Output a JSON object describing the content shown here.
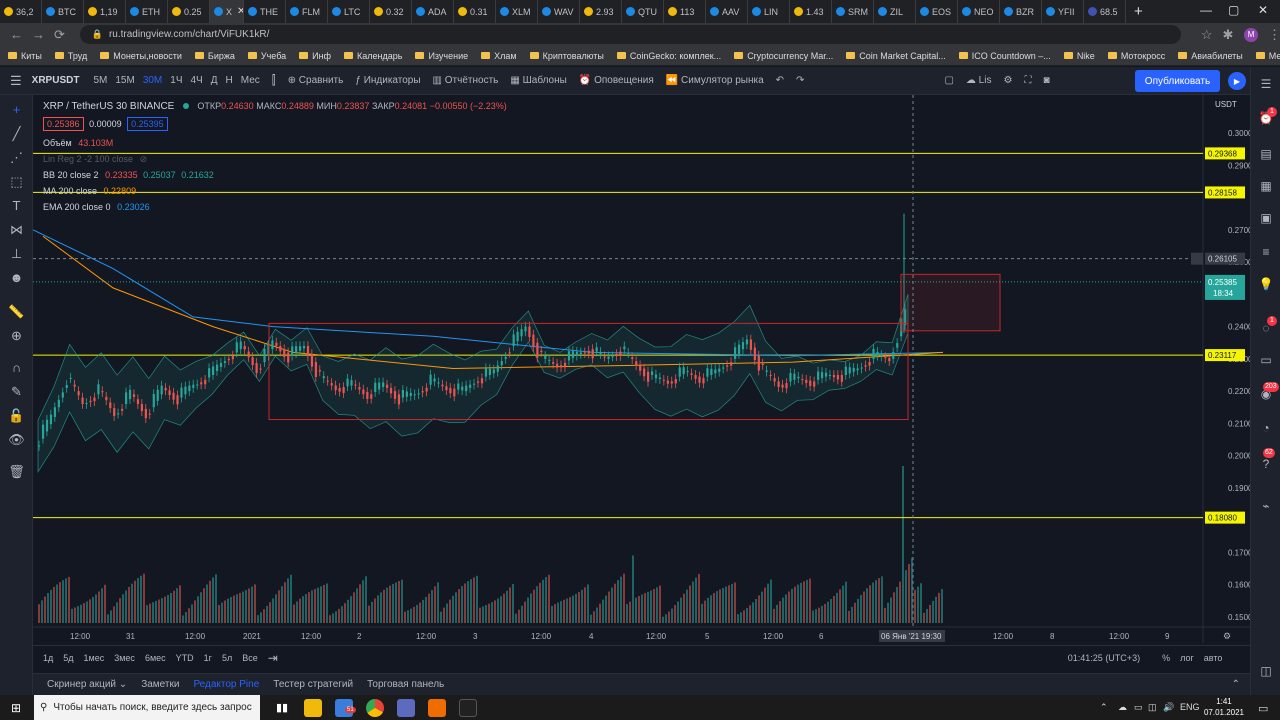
{
  "browser": {
    "tabs": [
      {
        "label": "36,2",
        "color": "#f0b90b"
      },
      {
        "label": "BTC",
        "color": "#1e88e5"
      },
      {
        "label": "1,19",
        "color": "#f0b90b"
      },
      {
        "label": "ETH",
        "color": "#1e88e5"
      },
      {
        "label": "0.25",
        "color": "#f0b90b"
      },
      {
        "label": "X",
        "color": "#1e88e5",
        "active": true
      },
      {
        "label": "THE",
        "color": "#1e88e5"
      },
      {
        "label": "FLM",
        "color": "#1e88e5"
      },
      {
        "label": "LTC",
        "color": "#1e88e5"
      },
      {
        "label": "0.32",
        "color": "#f0b90b"
      },
      {
        "label": "ADA",
        "color": "#1e88e5"
      },
      {
        "label": "0.31",
        "color": "#f0b90b"
      },
      {
        "label": "XLM",
        "color": "#1e88e5"
      },
      {
        "label": "WAV",
        "color": "#1e88e5"
      },
      {
        "label": "2.93",
        "color": "#f0b90b"
      },
      {
        "label": "QTU",
        "color": "#1e88e5"
      },
      {
        "label": "113",
        "color": "#f0b90b"
      },
      {
        "label": "AAV",
        "color": "#1e88e5"
      },
      {
        "label": "LIN",
        "color": "#1e88e5"
      },
      {
        "label": "1.43",
        "color": "#f0b90b"
      },
      {
        "label": "SRM",
        "color": "#1e88e5"
      },
      {
        "label": "ZIL",
        "color": "#1e88e5"
      },
      {
        "label": "EOS",
        "color": "#1e88e5"
      },
      {
        "label": "NEO",
        "color": "#1e88e5"
      },
      {
        "label": "BZR",
        "color": "#1e88e5"
      },
      {
        "label": "YFII",
        "color": "#1e88e5"
      },
      {
        "label": "68.5",
        "color": "#3f51b5"
      }
    ],
    "new_tab": "+",
    "url": "ru.tradingview.com/chart/ViFUK1kR/",
    "profile": "M",
    "bookmarks": [
      "Киты",
      "Труд",
      "Монеты,новости",
      "Биржа",
      "Учеба",
      "Инф",
      "Календарь",
      "Изучение",
      "Хлам",
      "Криптовалюты",
      "CoinGecko: комплек...",
      "Cryptocurrency Mar...",
      "Coin Market Capital...",
      "ICO Countdown –...",
      "Nike",
      "Мотокросс",
      "Авиабилеты",
      "Мерс"
    ]
  },
  "toolbar": {
    "symbol": "XRPUSDT",
    "intervals": [
      "5М",
      "15М",
      "30М",
      "1Ч",
      "4Ч",
      "Д",
      "Н",
      "Мес"
    ],
    "active_interval": "30М",
    "compare": "Сравнить",
    "indicators": "Индикаторы",
    "reports": "Отчётность",
    "templates": "Шаблоны",
    "alerts": "Оповещения",
    "replay": "Симулятор рынка",
    "layout_name": "Lis",
    "publish": "Опубликовать"
  },
  "legend": {
    "title": "XRP / TetherUS  30  BINANCE",
    "open_label": "ОТКР",
    "open": "0.24630",
    "high_label": "МАКС",
    "high": "0.24889",
    "low_label": "МИН",
    "low": "0.23837",
    "close_label": "ЗАКР",
    "close": "0.24081",
    "change": "−0.00550 (−2.23%)",
    "sell": "0.25386",
    "spread": "0.00009",
    "buy": "0.25395",
    "volume_label": "Объём",
    "volume": "43.103M",
    "linreg": "Lin Reg 2 -2 100 close",
    "bb_label": "BB 20 close 2",
    "bb_v1": "0.23335",
    "bb_v2": "0.25037",
    "bb_v3": "0.21632",
    "ma_label": "MA 200 close",
    "ma_v": "0.22809",
    "ema_label": "EMA 200 close 0",
    "ema_v": "0.23026"
  },
  "chart_data": {
    "type": "candlestick",
    "symbol": "XRP / TetherUS",
    "interval": "30",
    "exchange": "BINANCE",
    "price_axis": {
      "currency": "USDT",
      "ticks": [
        "0.30000",
        "0.29000",
        "0.27000",
        "0.26000",
        "0.24000",
        "0.23000",
        "0.22000",
        "0.21000",
        "0.20000",
        "0.19000",
        "0.17000",
        "0.16000",
        "0.15000"
      ]
    },
    "time_axis": {
      "ticks": [
        "12:00",
        "31",
        "12:00",
        "2021",
        "12:00",
        "2",
        "12:00",
        "3",
        "12:00",
        "4",
        "12:00",
        "5",
        "12:00",
        "6",
        "12:",
        "12:00",
        "8",
        "12:00",
        "9"
      ],
      "cursor_date": "06 Янв '21",
      "cursor_time": "19:30"
    },
    "horizontal_levels": [
      {
        "price": 0.29368,
        "label": "0.29368",
        "color": "#f5f500"
      },
      {
        "price": 0.28158,
        "label": "0.28158",
        "color": "#f5f500"
      },
      {
        "price": 0.23117,
        "label": "0.23117",
        "color": "#f5f500"
      },
      {
        "price": 0.1808,
        "label": "0.18080",
        "color": "#f5f500"
      }
    ],
    "crosshair_price": "0.26105",
    "last_price": "0.25385",
    "countdown": "18:34",
    "rectangles": [
      {
        "from_price": 0.241,
        "to_price": 0.2112,
        "color": "#c2282b"
      },
      {
        "from_price": 0.2562,
        "to_price": 0.2387,
        "color": "#c2282b"
      }
    ],
    "price_path": [
      [
        0,
        0.203
      ],
      [
        10,
        0.212
      ],
      [
        20,
        0.224
      ],
      [
        30,
        0.216
      ],
      [
        40,
        0.22
      ],
      [
        50,
        0.213
      ],
      [
        60,
        0.219
      ],
      [
        70,
        0.213
      ],
      [
        80,
        0.221
      ],
      [
        90,
        0.218
      ],
      [
        100,
        0.222
      ],
      [
        110,
        0.225
      ],
      [
        120,
        0.23
      ],
      [
        130,
        0.234
      ],
      [
        140,
        0.227
      ],
      [
        150,
        0.235
      ],
      [
        160,
        0.231
      ],
      [
        170,
        0.234
      ],
      [
        180,
        0.224
      ],
      [
        190,
        0.221
      ],
      [
        200,
        0.222
      ],
      [
        210,
        0.219
      ],
      [
        220,
        0.222
      ],
      [
        230,
        0.218
      ],
      [
        240,
        0.219
      ],
      [
        250,
        0.223
      ],
      [
        260,
        0.221
      ],
      [
        270,
        0.22
      ],
      [
        280,
        0.224
      ],
      [
        290,
        0.226
      ],
      [
        300,
        0.234
      ],
      [
        310,
        0.24
      ],
      [
        320,
        0.23
      ],
      [
        330,
        0.228
      ],
      [
        340,
        0.231
      ],
      [
        350,
        0.233
      ],
      [
        360,
        0.23
      ],
      [
        370,
        0.233
      ],
      [
        380,
        0.228
      ],
      [
        390,
        0.224
      ],
      [
        400,
        0.223
      ],
      [
        410,
        0.226
      ],
      [
        420,
        0.224
      ],
      [
        430,
        0.226
      ],
      [
        440,
        0.23
      ],
      [
        450,
        0.236
      ],
      [
        460,
        0.226
      ],
      [
        470,
        0.222
      ],
      [
        480,
        0.224
      ],
      [
        490,
        0.223
      ],
      [
        500,
        0.225
      ],
      [
        510,
        0.225
      ],
      [
        520,
        0.227
      ],
      [
        530,
        0.231
      ],
      [
        540,
        0.23
      ],
      [
        550,
        0.244
      ]
    ],
    "volume_axis": "histogram"
  },
  "bottom": {
    "ranges": [
      "1д",
      "5д",
      "1мес",
      "3мес",
      "6мес",
      "YTD",
      "1г",
      "5л",
      "Все"
    ],
    "time": "01:41:25 (UTC+3)",
    "percent": "%",
    "log": "лог",
    "auto": "авто"
  },
  "panels": [
    "Скринер акций",
    "Заметки",
    "Редактор Pine",
    "Тестер стратегий",
    "Торговая панель"
  ],
  "active_panel": "Редактор Pine",
  "taskbar": {
    "search_placeholder": "Чтобы начать поиск, введите здесь запрос",
    "lang": "ENG",
    "time": "1:41",
    "date": "07.01.2021",
    "badge": "51"
  },
  "right_badges": {
    "alerts": "1",
    "chats": "1",
    "notif1": "203",
    "notif2": "62"
  }
}
